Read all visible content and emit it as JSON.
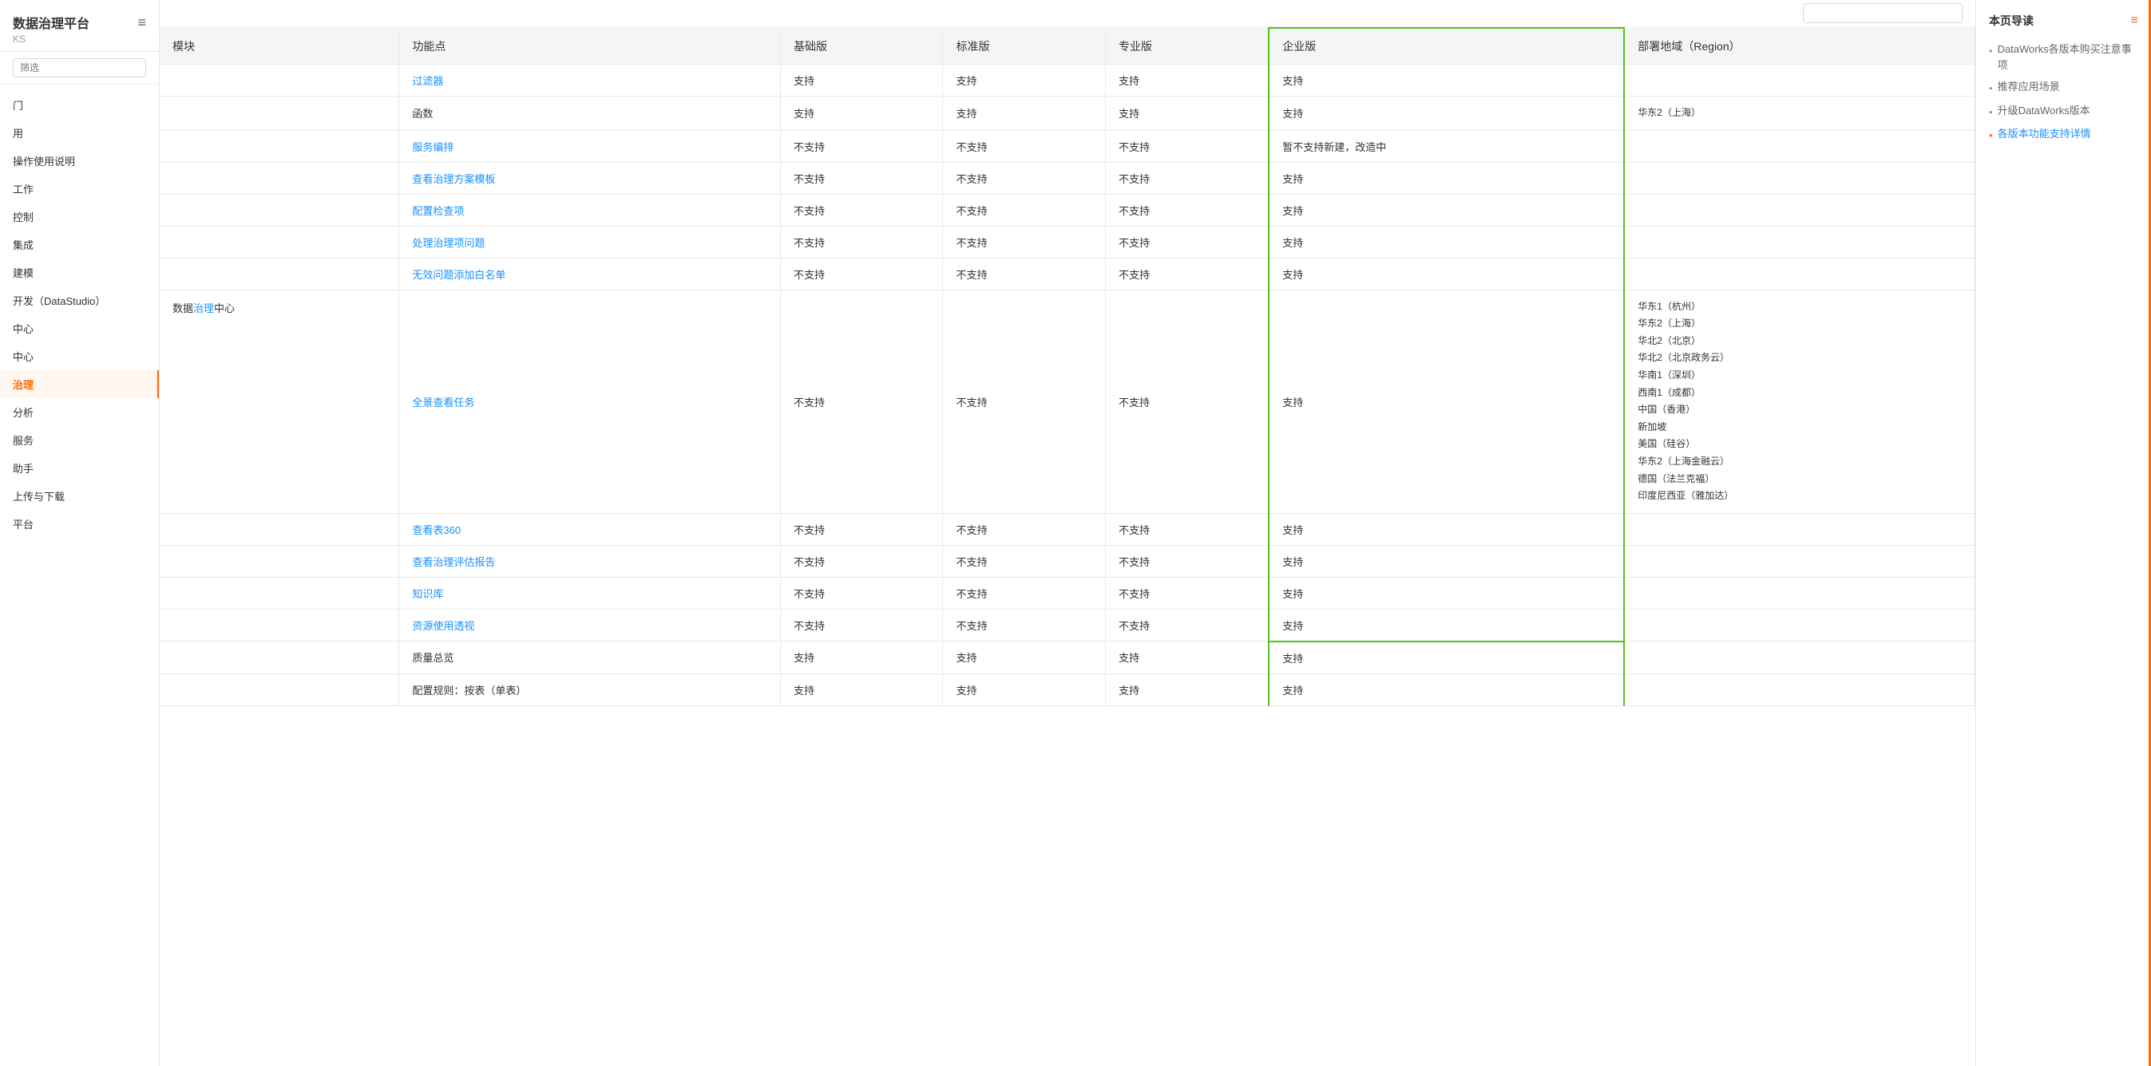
{
  "sidebar": {
    "title": "数据治理平台",
    "subtitle": "KS",
    "search_placeholder": "筛选",
    "hamburger": "≡",
    "items": [
      {
        "label": "门",
        "active": false
      },
      {
        "label": "用",
        "active": false
      },
      {
        "label": "操作使用说明",
        "active": false
      },
      {
        "label": "工作",
        "active": false
      },
      {
        "label": "控制",
        "active": false
      },
      {
        "label": "集成",
        "active": false
      },
      {
        "label": "建模",
        "active": false
      },
      {
        "label": "开发（DataStudio）",
        "active": false
      },
      {
        "label": "中心",
        "active": false
      },
      {
        "label": "中心",
        "active": false
      },
      {
        "label": "治理",
        "active": true
      },
      {
        "label": "分析",
        "active": false
      },
      {
        "label": "服务",
        "active": false
      },
      {
        "label": "助手",
        "active": false
      },
      {
        "label": "上传与下载",
        "active": false
      },
      {
        "label": "平台",
        "active": false
      }
    ]
  },
  "table": {
    "headers": [
      "模块",
      "功能点",
      "基础版",
      "标准版",
      "专业版",
      "企业版",
      "部署地域（Region）"
    ],
    "rows": [
      {
        "module": "",
        "feature": "过滤器",
        "feature_link": true,
        "basic": "支持",
        "standard": "支持",
        "pro": "支持",
        "enterprise": "支持",
        "region": ""
      },
      {
        "module": "",
        "feature": "函数",
        "feature_link": false,
        "basic": "支持",
        "standard": "支持",
        "pro": "支持",
        "enterprise": "支持",
        "region": "华东2（上海）"
      },
      {
        "module": "",
        "feature": "服务编排",
        "feature_link": true,
        "basic": "不支持",
        "standard": "不支持",
        "pro": "不支持",
        "enterprise": "暂不支持新建，改造中",
        "region": ""
      },
      {
        "module": "",
        "feature": "查看治理方案模板",
        "feature_link": true,
        "basic": "不支持",
        "standard": "不支持",
        "pro": "不支持",
        "enterprise": "支持",
        "region": ""
      },
      {
        "module": "",
        "feature": "配置检查项",
        "feature_link": true,
        "basic": "不支持",
        "standard": "不支持",
        "pro": "不支持",
        "enterprise": "支持",
        "region": ""
      },
      {
        "module": "",
        "feature": "处理治理项问题",
        "feature_link": true,
        "basic": "不支持",
        "standard": "不支持",
        "pro": "不支持",
        "enterprise": "支持",
        "region": ""
      },
      {
        "module": "",
        "feature": "无效问题添加白名单",
        "feature_link": true,
        "basic": "不支持",
        "standard": "不支持",
        "pro": "不支持",
        "enterprise": "支持",
        "region": ""
      },
      {
        "module": "数据治理中心",
        "feature": "全景查看任务",
        "feature_link": true,
        "basic": "不支持",
        "standard": "不支持",
        "pro": "不支持",
        "enterprise": "支持",
        "region": "华东1（杭州）\n华东2（上海）\n华北2（北京）\n华北2（北京政务云）\n华南1（深圳）\n西南1（成都）\n中国（香港）\n新加坡\n美国（硅谷）\n华东2（上海金融云）\n德国（法兰克福）\n印度尼西亚（雅加达）"
      },
      {
        "module": "",
        "feature": "查看表360",
        "feature_link": true,
        "basic": "不支持",
        "standard": "不支持",
        "pro": "不支持",
        "enterprise": "支持",
        "region": ""
      },
      {
        "module": "",
        "feature": "查看治理评估报告",
        "feature_link": true,
        "basic": "不支持",
        "standard": "不支持",
        "pro": "不支持",
        "enterprise": "支持",
        "region": ""
      },
      {
        "module": "",
        "feature": "知识库",
        "feature_link": true,
        "basic": "不支持",
        "standard": "不支持",
        "pro": "不支持",
        "enterprise": "支持",
        "region": ""
      },
      {
        "module": "",
        "feature": "资源使用透视",
        "feature_link": true,
        "basic": "不支持",
        "standard": "不支持",
        "pro": "不支持",
        "enterprise": "支持",
        "region": ""
      },
      {
        "module": "",
        "feature": "质量总览",
        "feature_link": false,
        "basic": "支持",
        "standard": "支持",
        "pro": "支持",
        "enterprise": "支持",
        "region": ""
      },
      {
        "module": "",
        "feature": "配置规则：按表（单表）",
        "feature_link": false,
        "basic": "支持",
        "standard": "支持",
        "pro": "支持",
        "enterprise": "支持",
        "region": ""
      }
    ]
  },
  "right_sidebar": {
    "title": "本页导读",
    "items": [
      {
        "label": "DataWorks各版本购买注意事项",
        "active": false,
        "link": false
      },
      {
        "label": "推荐应用场景",
        "active": false,
        "link": false
      },
      {
        "label": "升级DataWorks版本",
        "active": false,
        "link": false
      },
      {
        "label": "各版本功能支持详情",
        "active": true,
        "link": true
      }
    ]
  },
  "search": {
    "placeholder": ""
  }
}
